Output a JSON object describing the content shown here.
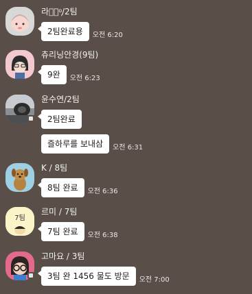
{
  "conversation": [
    {
      "sender": "라현᷊ᵒ᷊/2팀",
      "avatar_icon": "pink-character-avatar-icon",
      "messages": [
        {
          "text": "2팀완료용",
          "time": "오전 6:20"
        }
      ]
    },
    {
      "sender": "츄리닝안경(9팀)",
      "avatar_icon": "dark-haired-doll-avatar-icon",
      "messages": [
        {
          "text": "9완",
          "time": "오전 6:23"
        }
      ]
    },
    {
      "sender": "윤수연/2팀",
      "avatar_icon": "photo-avatar-icon",
      "messages": [
        {
          "text": "2팀완료",
          "time": ""
        },
        {
          "text": "즐하루를 보내삼",
          "time": "오전 6:31"
        }
      ]
    },
    {
      "sender": "K / 8팀",
      "avatar_icon": "brown-dog-avatar-icon",
      "messages": [
        {
          "text": "8팀 완료",
          "time": "오전 6:36"
        }
      ]
    },
    {
      "sender": "르미 / 7팀",
      "avatar_icon": "yellow-face-avatar-icon",
      "avatar_text": "7팀",
      "messages": [
        {
          "text": "7팀 완료",
          "time": "오전 6:38"
        }
      ]
    },
    {
      "sender": "고마요 / 3팀",
      "avatar_icon": "glasses-character-avatar-icon",
      "messages": [
        {
          "text": "3팀 완 1456 물도 방문",
          "time": "오전 7:00"
        }
      ]
    }
  ],
  "colors": {
    "background": "#5a4f48",
    "bubble": "#ffffff",
    "text_light": "#f2f2f2"
  }
}
